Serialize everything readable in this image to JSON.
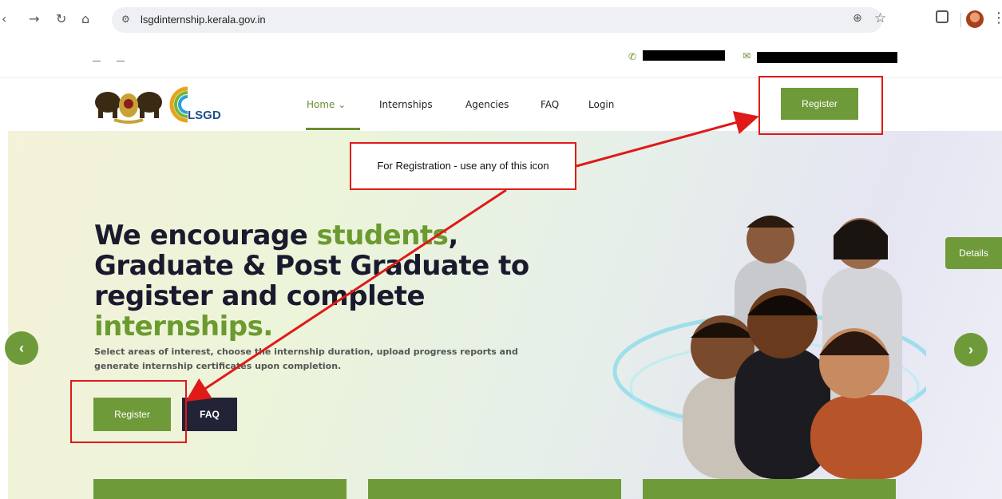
{
  "browser": {
    "url": "lsgdinternship.kerala.gov.in",
    "icons": [
      "back-icon",
      "forward-icon",
      "reload-icon",
      "home-icon",
      "site-info-icon",
      "zoom-icon",
      "bookmark-star-icon",
      "extensions-icon",
      "profile-avatar",
      "menu-kebab-icon"
    ]
  },
  "topbar": {
    "phone_icon": "phone-icon",
    "mail_icon": "mail-icon"
  },
  "nav": {
    "items": [
      {
        "label": "Home ⌄",
        "active": true
      },
      {
        "label": "Internships",
        "active": false
      },
      {
        "label": "Agencies",
        "active": false
      },
      {
        "label": "FAQ",
        "active": false
      },
      {
        "label": "Login",
        "active": false
      }
    ],
    "register_label": "Register"
  },
  "logo": {
    "text": "LSGD"
  },
  "hero": {
    "title_part1": "We encourage ",
    "title_green1": "students",
    "title_part2": ", Graduate & Post Graduate to register and complete ",
    "title_green2": "internships.",
    "subtitle": "Select areas of interest, choose the internship duration, upload progress reports and generate internship certificates upon completion.",
    "register_label": "Register",
    "faq_label": "FAQ",
    "details_label": "Details"
  },
  "annotation": {
    "label": "For Registration - use any of this icon"
  },
  "colors": {
    "brand_green": "#6f9a3a",
    "dark_button": "#232338",
    "annotation_red": "#e01919"
  }
}
